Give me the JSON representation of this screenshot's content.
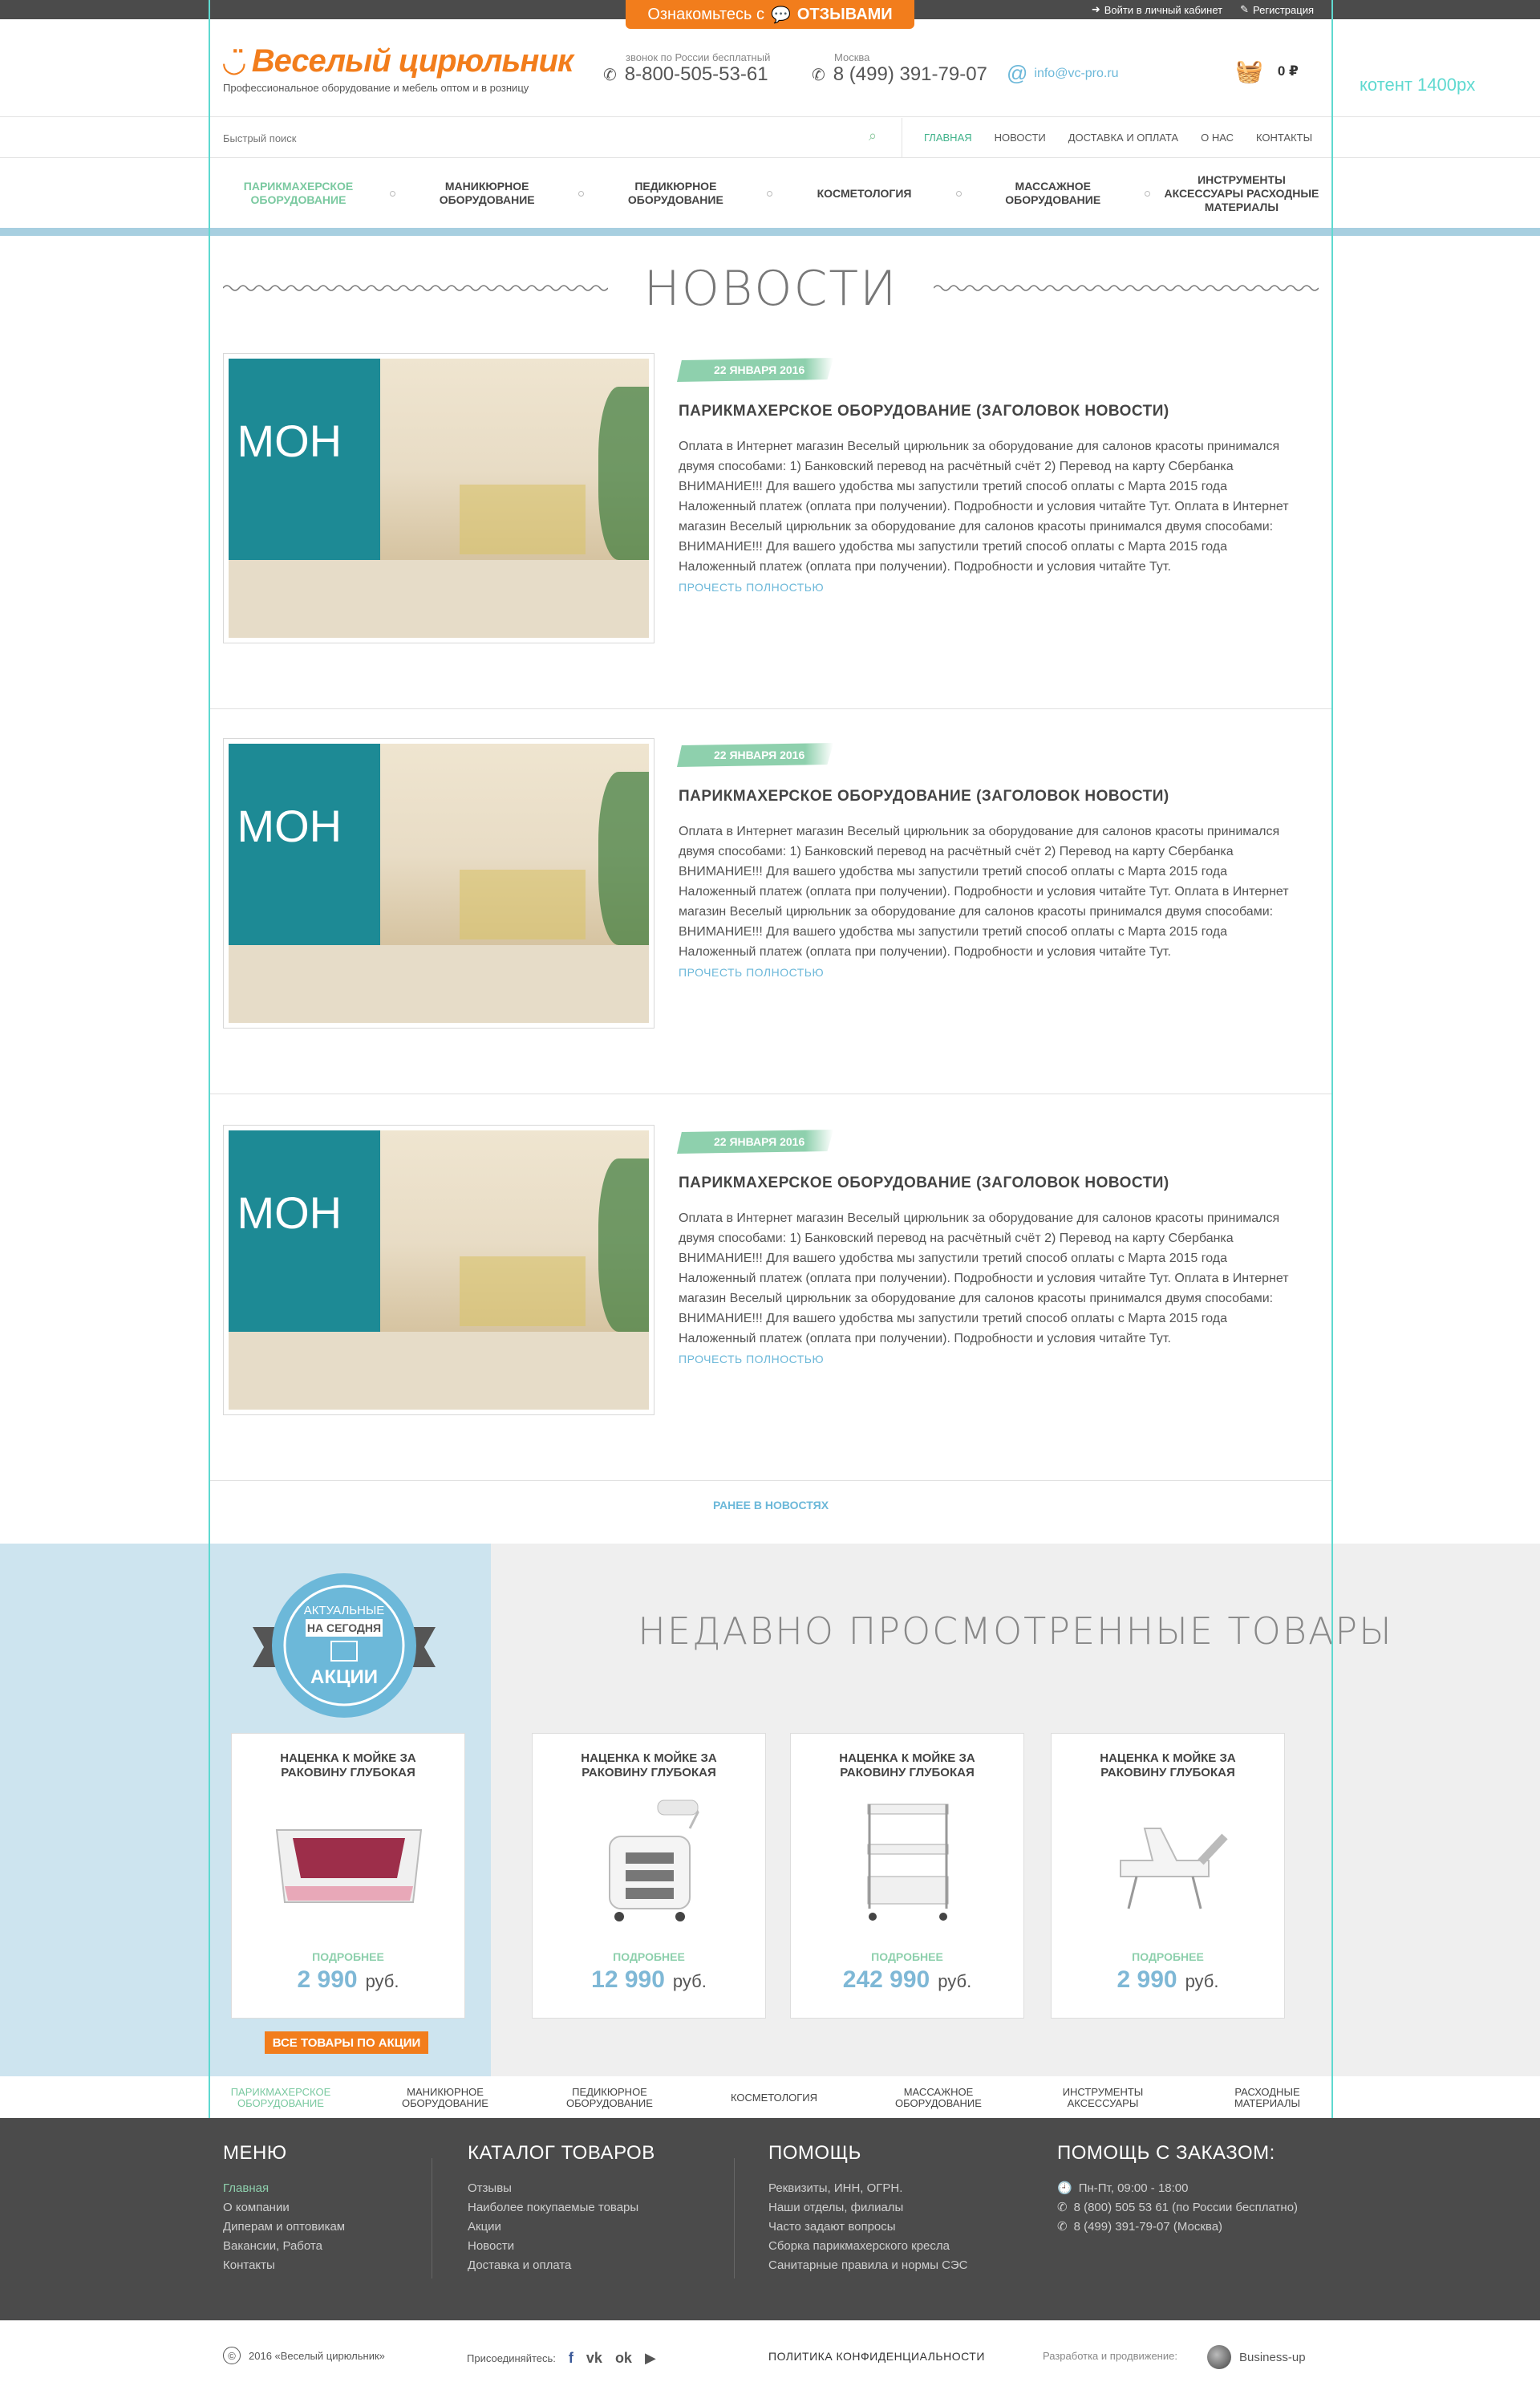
{
  "topbar": {
    "reviews_prefix": "Ознакомьтесь с",
    "reviews_label": "ОТЗЫВАМИ",
    "login": "Войти в личный кабинет",
    "register": "Регистрация"
  },
  "header": {
    "logo_text": "Веселый цирюльник",
    "tagline": "Профессиональное оборудование и мебель оптом и в розницу",
    "phone1": {
      "caption": "звонок по России бесплатный",
      "number": "8-800-505-53-61"
    },
    "phone2": {
      "caption": "Москва",
      "number": "8 (499) 391-79-07"
    },
    "email": "info@vc-pro.ru",
    "cart_total": "0 ₽",
    "content_note": "котент 1400px"
  },
  "search": {
    "placeholder": "Быстрый поиск"
  },
  "topnav": [
    "ГЛАВНАЯ",
    "НОВОСТИ",
    "ДОСТАВКА И ОПЛАТА",
    "О НАС",
    "КОНТАКТЫ"
  ],
  "catnav": [
    "ПАРИКМАХЕРСКОЕ ОБОРУДОВАНИЕ",
    "МАНИКЮРНОЕ ОБОРУДОВАНИЕ",
    "ПЕДИКЮРНОЕ ОБОРУДОВАНИЕ",
    "КОСМЕТОЛОГИЯ",
    "МАССАЖНОЕ ОБОРУДОВАНИЕ",
    "ИНСТРУМЕНТЫ АКСЕССУАРЫ РАСХОДНЫЕ МАТЕРИАЛЫ"
  ],
  "news": {
    "title": "НОВОСТИ",
    "items": [
      {
        "date": "22 ЯНВАРЯ 2016",
        "heading": "ПАРИКМАХЕРСКОЕ ОБОРУДОВАНИЕ (ЗАГОЛОВОК НОВОСТИ)",
        "text": "Оплата в Интернет магазин Веселый цирюльник за оборудование для салонов красоты принимался двумя способами: 1) Банковский перевод на расчётный счёт 2) Перевод на карту Сбербанка ВНИМАНИЕ!!! Для вашего удобства мы запустили третий способ оплаты с Марта 2015 года Наложенный платеж (оплата при получении). Подробности и условия читайте Тут. Оплата в Интернет магазин Веселый цирюльник за оборудование для салонов красоты принимался двумя способами: ВНИМАНИЕ!!! Для вашего удобства мы запустили третий способ оплаты с Марта 2015 года Наложенный платеж (оплата при получении). Подробности и условия читайте Тут.",
        "more": "ПРОЧЕСТЬ ПОЛНОСТЬЮ"
      },
      {
        "date": "22 ЯНВАРЯ 2016",
        "heading": "ПАРИКМАХЕРСКОЕ ОБОРУДОВАНИЕ (ЗАГОЛОВОК НОВОСТИ)",
        "text": "Оплата в Интернет магазин Веселый цирюльник за оборудование для салонов красоты принимался двумя способами: 1) Банковский перевод на расчётный счёт 2) Перевод на карту Сбербанка ВНИМАНИЕ!!! Для вашего удобства мы запустили третий способ оплаты с Марта 2015 года Наложенный платеж (оплата при получении). Подробности и условия читайте Тут. Оплата в Интернет магазин Веселый цирюльник за оборудование для салонов красоты принимался двумя способами: ВНИМАНИЕ!!! Для вашего удобства мы запустили третий способ оплаты с Марта 2015 года Наложенный платеж (оплата при получении). Подробности и условия читайте Тут.",
        "more": "ПРОЧЕСТЬ ПОЛНОСТЬЮ"
      },
      {
        "date": "22 ЯНВАРЯ 2016",
        "heading": "ПАРИКМАХЕРСКОЕ ОБОРУДОВАНИЕ (ЗАГОЛОВОК НОВОСТИ)",
        "text": "Оплата в Интернет магазин Веселый цирюльник за оборудование для салонов красоты принимался двумя способами: 1) Банковский перевод на расчётный счёт 2) Перевод на карту Сбербанка ВНИМАНИЕ!!! Для вашего удобства мы запустили третий способ оплаты с Марта 2015 года Наложенный платеж (оплата при получении). Подробности и условия читайте Тут. Оплата в Интернет магазин Веселый цирюльник за оборудование для салонов красоты принимался двумя способами: ВНИМАНИЕ!!! Для вашего удобства мы запустили третий способ оплаты с Марта 2015 года Наложенный платеж (оплата при получении). Подробности и условия читайте Тут.",
        "more": "ПРОЧЕСТЬ ПОЛНОСТЬЮ"
      }
    ],
    "earlier": "РАНЕЕ В НОВОСТЯХ"
  },
  "recent": {
    "title": "НЕДАВНО ПРОСМОТРЕННЫЕ ТОВАРЫ",
    "badge": {
      "line1": "АКТУАЛЬНЫЕ",
      "line2": "НА СЕГОДНЯ",
      "line3": "АКЦИИ"
    },
    "all_promo": "ВСЕ ТОВАРЫ ПО АКЦИИ",
    "products": [
      {
        "name": "НАЦЕНКА К МОЙКЕ ЗА РАКОВИНУ ГЛУБОКАЯ",
        "more": "ПОДРОБНЕЕ",
        "price": "2 990",
        "currency": "руб."
      },
      {
        "name": "НАЦЕНКА К МОЙКЕ ЗА РАКОВИНУ ГЛУБОКАЯ",
        "more": "ПОДРОБНЕЕ",
        "price": "12 990",
        "currency": "руб."
      },
      {
        "name": "НАЦЕНКА К МОЙКЕ ЗА РАКОВИНУ ГЛУБОКАЯ",
        "more": "ПОДРОБНЕЕ",
        "price": "242 990",
        "currency": "руб."
      },
      {
        "name": "НАЦЕНКА К МОЙКЕ ЗА РАКОВИНУ ГЛУБОКАЯ",
        "more": "ПОДРОБНЕЕ",
        "price": "2 990",
        "currency": "руб."
      }
    ]
  },
  "botnav": [
    "ПАРИКМАХЕРСКОЕ ОБОРУДОВАНИЕ",
    "МАНИКЮРНОЕ ОБОРУДОВАНИЕ",
    "ПЕДИКЮРНОЕ ОБОРУДОВАНИЕ",
    "КОСМЕТОЛОГИЯ",
    "МАССАЖНОЕ ОБОРУДОВАНИЕ",
    "ИНСТРУМЕНТЫ АКСЕССУАРЫ",
    "РАСХОДНЫЕ МАТЕРИАЛЫ"
  ],
  "footer": {
    "menu": {
      "title": "МЕНЮ",
      "items": [
        "Главная",
        "О компании",
        "Диперам и оптовикам",
        "Вакансии, Работа",
        "Контакты"
      ]
    },
    "catalog": {
      "title": "КАТАЛОГ ТОВАРОВ",
      "items": [
        "Отзывы",
        "Наиболее покупаемые товары",
        "Акции",
        "Новости",
        "Доставка и оплата"
      ]
    },
    "help": {
      "title": "ПОМОЩЬ",
      "items": [
        "Реквизиты, ИНН, ОГРН.",
        "Наши отделы, филиалы",
        "Часто задают вопросы",
        "Сборка парикмахерского кресла",
        "Санитарные правила и нормы СЭС"
      ]
    },
    "order_help": {
      "title": "ПОМОЩЬ С ЗАКАЗОМ:",
      "items": [
        "Пн-Пт, 09:00 - 18:00",
        "8 (800) 505 53 61 (по России бесплатно)",
        "8 (499) 391-79-07 (Москва)"
      ]
    }
  },
  "legal": {
    "copyright": "2016 «Веселый цирюльник»",
    "join": "Присоединяйтесь:",
    "policy": "ПОЛИТИКА КОНФИДЕНЦИАЛЬНОСТИ",
    "dev": "Разработка и продвижение:",
    "dev_name": "Business-up"
  },
  "colors": {
    "accent": "#f27d1c",
    "green": "#8ed0ad",
    "blue": "#6cb8d9",
    "footer_bg": "#4b4b4b",
    "guide": "#5fd9d0"
  }
}
